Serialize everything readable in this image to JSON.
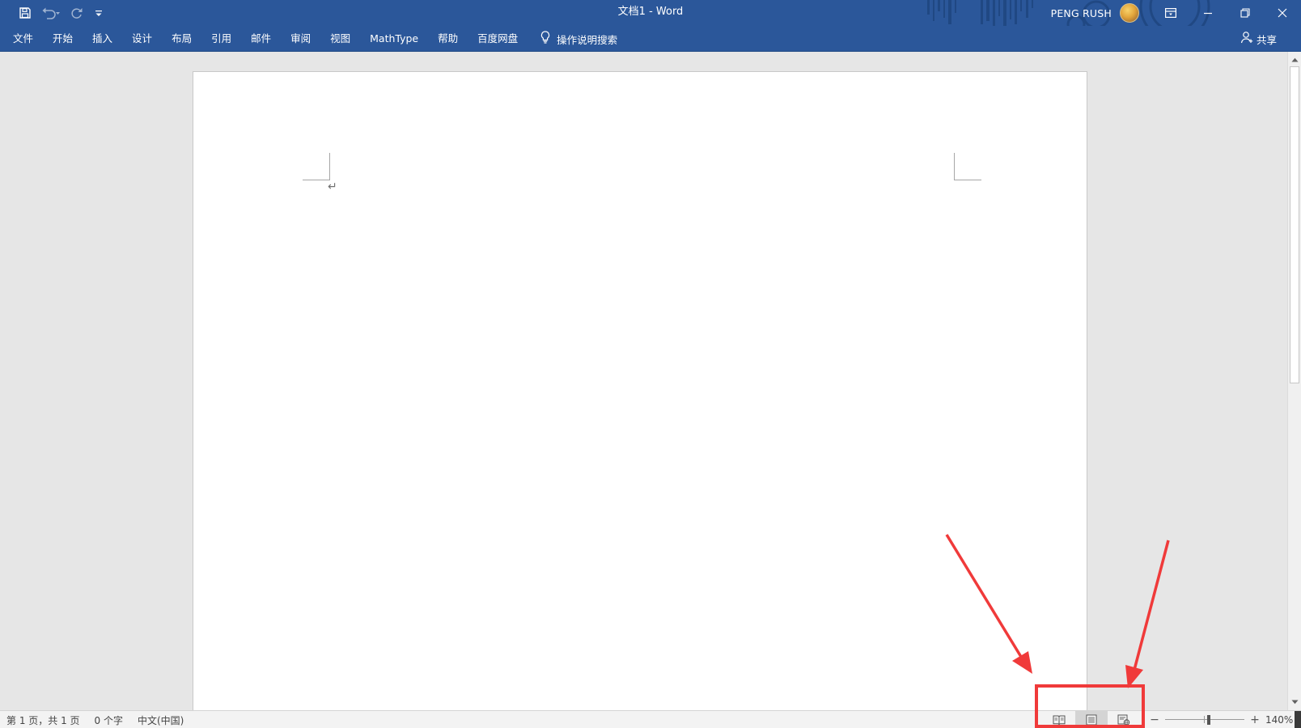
{
  "titlebar": {
    "title": "文档1  -  Word",
    "user_name": "PENG RUSH",
    "quick_access": [
      "save-icon",
      "undo-icon",
      "redo-icon",
      "customize-qat-icon"
    ],
    "window_controls": [
      "ribbon-display-options-icon",
      "minimize-icon",
      "restore-icon",
      "close-icon"
    ]
  },
  "ribbon": {
    "tabs": [
      "文件",
      "开始",
      "插入",
      "设计",
      "布局",
      "引用",
      "邮件",
      "审阅",
      "视图",
      "MathType",
      "帮助",
      "百度网盘"
    ],
    "tell_me": "操作说明搜索",
    "share": "共享"
  },
  "document": {
    "paragraph_mark": "↵"
  },
  "statusbar": {
    "page_info": "第 1 页，共 1 页",
    "word_count": "0 个字",
    "language": "中文(中国)",
    "view_buttons": [
      "read-mode-icon",
      "print-layout-icon",
      "web-layout-icon"
    ],
    "active_view": "print-layout",
    "zoom_out": "−",
    "zoom_in": "+",
    "zoom_level": "140%",
    "zoom_value": 140
  },
  "colors": {
    "accent": "#2b579a",
    "workspace": "#e6e6e6",
    "annotation": "#f03a3a"
  }
}
